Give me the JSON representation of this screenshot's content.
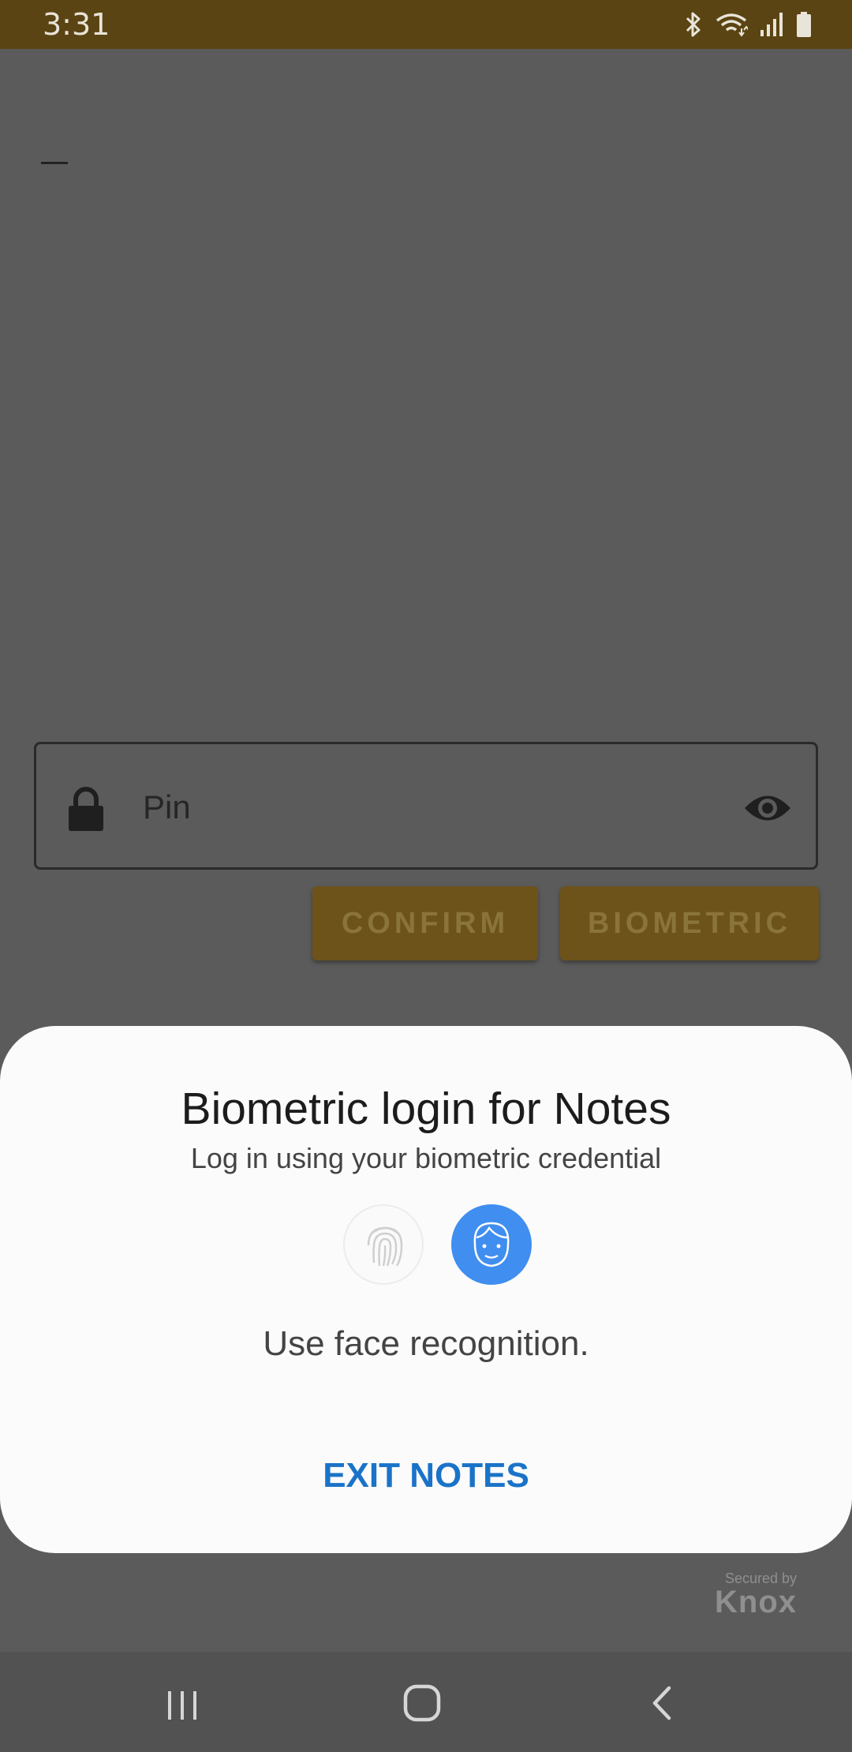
{
  "status_bar": {
    "time": "3:31",
    "icons": [
      "bluetooth-icon",
      "wifi-icon",
      "signal-icon",
      "battery-icon"
    ]
  },
  "app": {
    "pin_field": {
      "placeholder": "Pin",
      "leading_icon": "lock-icon",
      "trailing_icon": "eye-icon"
    },
    "buttons": {
      "confirm": "CONFIRM",
      "biometric": "BIOMETRIC"
    },
    "accent_color": "#c08a1e"
  },
  "dialog": {
    "title": "Biometric login for Notes",
    "subtitle": "Log in using your biometric credential",
    "options": [
      "fingerprint-icon",
      "face-icon"
    ],
    "selected_option": "face-icon",
    "hint": "Use face recognition.",
    "exit_label": "EXIT NOTES",
    "accent_color": "#3f8ef0",
    "link_color": "#1a73c8"
  },
  "branding": {
    "secured_by": "Secured by",
    "name": "Knox"
  },
  "nav_bar": {
    "items": [
      "recent-apps-icon",
      "home-icon",
      "back-icon"
    ]
  }
}
